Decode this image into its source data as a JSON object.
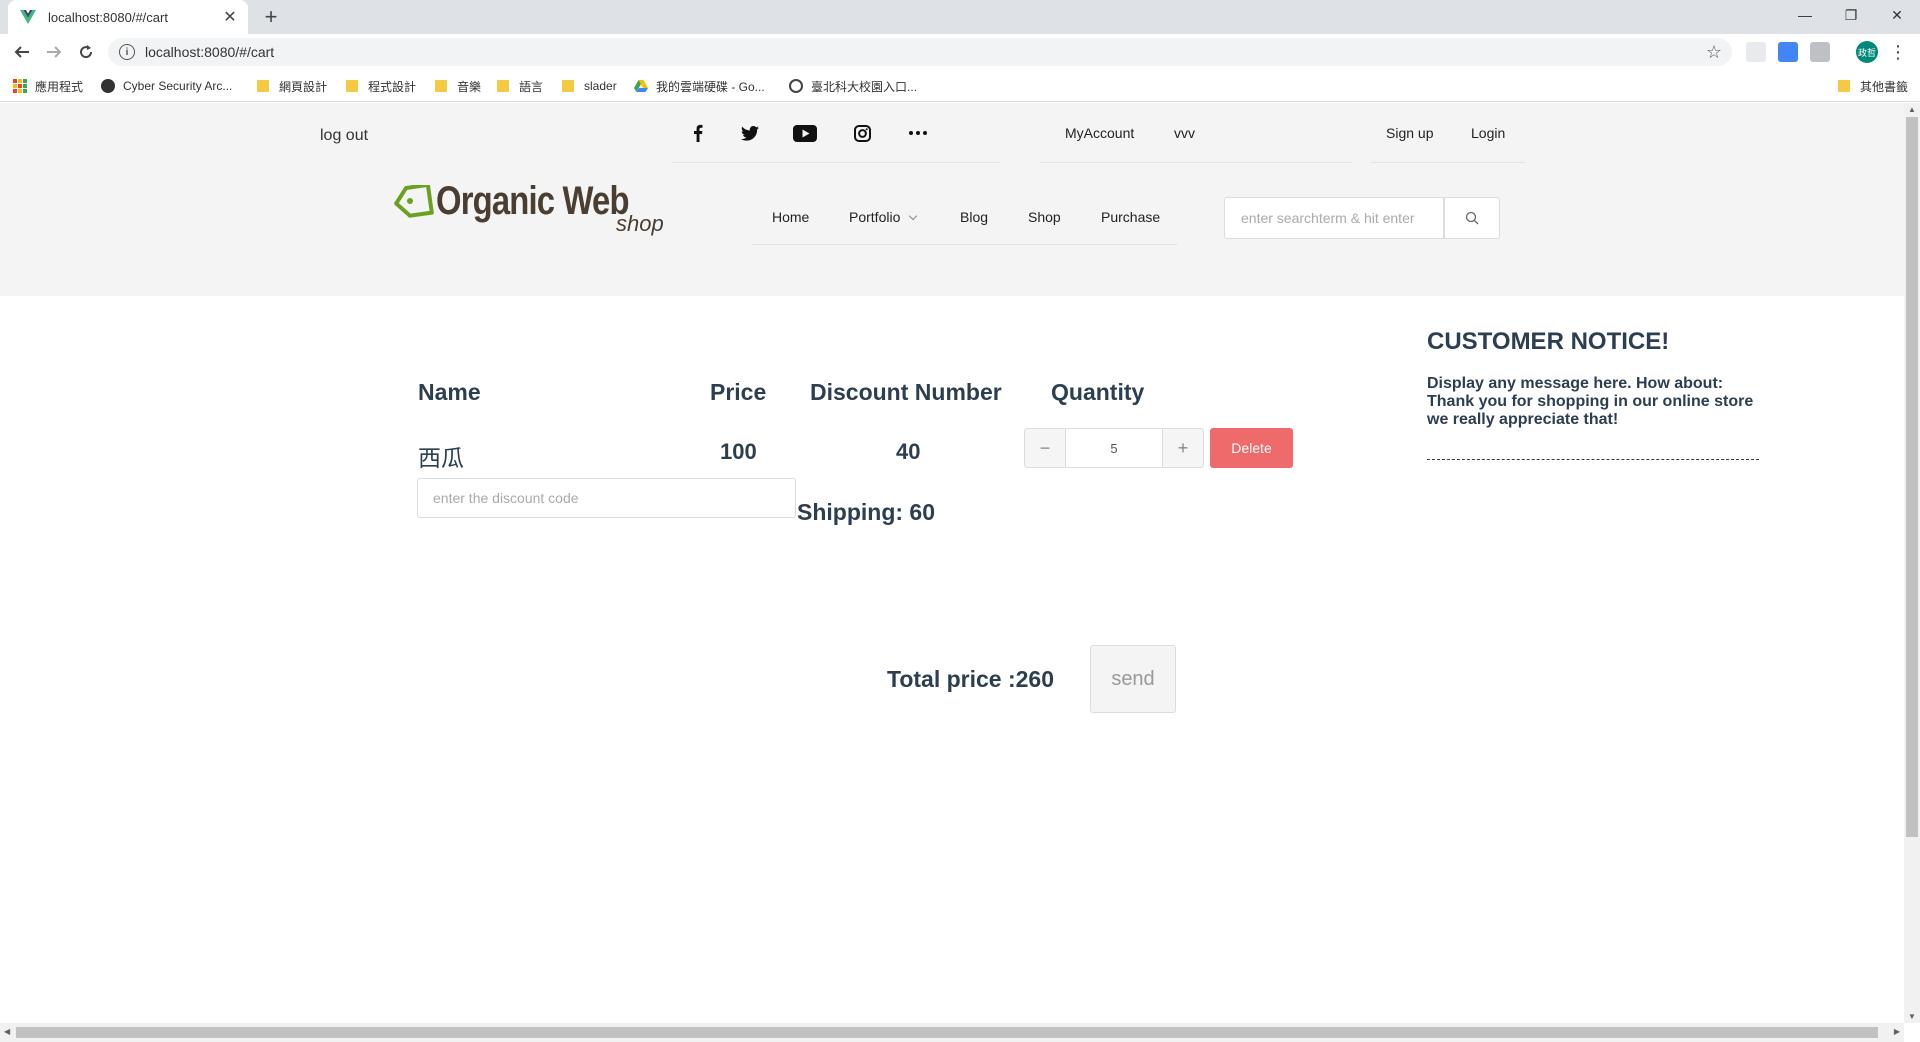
{
  "browser": {
    "tab_title": "localhost:8080/#/cart",
    "url": "localhost:8080/#/cart",
    "profile_initials": "政哲",
    "bookmarks": [
      {
        "label": "應用程式",
        "icon": "apps-icon"
      },
      {
        "label": "Cyber Security Arc...",
        "icon": "site-icon"
      },
      {
        "label": "網頁設計",
        "icon": "folder-icon"
      },
      {
        "label": "程式設計",
        "icon": "folder-icon"
      },
      {
        "label": "音樂",
        "icon": "folder-icon"
      },
      {
        "label": "語言",
        "icon": "folder-icon"
      },
      {
        "label": "slader",
        "icon": "folder-icon"
      },
      {
        "label": "我的雲端硬碟 - Go...",
        "icon": "drive-icon"
      },
      {
        "label": "臺北科大校園入口...",
        "icon": "globe-icon"
      }
    ],
    "other_bookmarks": "其他書籤"
  },
  "header": {
    "logout": "log out",
    "account_links": [
      "MyAccount",
      "vvv"
    ],
    "auth_links": [
      "Sign up",
      "Login"
    ],
    "logo_name": "Organic Web",
    "logo_sub": "shop",
    "nav": [
      "Home",
      "Portfolio",
      "Blog",
      "Shop",
      "Purchase"
    ],
    "search_placeholder": "enter searchterm & hit enter",
    "social_icons": [
      "facebook-icon",
      "twitter-icon",
      "youtube-icon",
      "instagram-icon",
      "more-icon"
    ]
  },
  "cart": {
    "columns": [
      "Name",
      "Price",
      "Discount Number",
      "Quantity"
    ],
    "item": {
      "name": "西瓜",
      "price": "100",
      "discount_number": "40",
      "quantity": "5"
    },
    "delete_label": "Delete",
    "discount_placeholder": "enter the discount code",
    "shipping": "Shipping: 60",
    "total": "Total price :260",
    "send_label": "send"
  },
  "notice": {
    "title": "CUSTOMER NOTICE!",
    "body": "Display any message here. How about: Thank you for shopping in our online store we really appreciate that!"
  },
  "colors": {
    "delete": "#ef6b6b",
    "heading": "#2c3e50",
    "header_bg": "#f4f4f4",
    "logo": "#4a3d31",
    "logo_tag": "#6aa121"
  }
}
